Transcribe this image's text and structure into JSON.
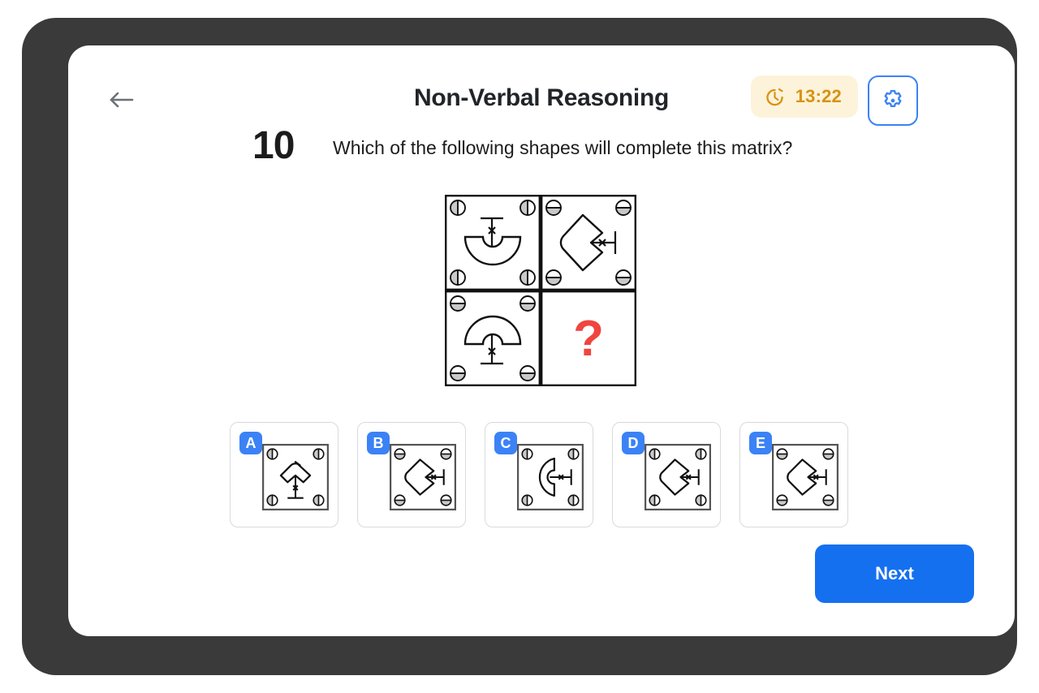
{
  "header": {
    "back_icon": "arrow-left-icon",
    "title": "Non-Verbal Reasoning",
    "timer": {
      "icon": "clock-icon",
      "value": "13:22",
      "bg_color": "#fdf3da",
      "text_color": "#d79311"
    },
    "settings": {
      "icon": "gear-icon",
      "accent_color": "#3b82f6"
    }
  },
  "question": {
    "number": "10",
    "text": "Which of the following shapes will complete this matrix?"
  },
  "matrix": {
    "missing_marker": "?",
    "missing_marker_color": "#f0453f",
    "cells": [
      {
        "position": "top-left",
        "corner_marker": "circle-split-vertical-left-shaded",
        "shape": "semicircle-down-notched",
        "stem": "vertical-line-top-tee-with-x"
      },
      {
        "position": "top-right",
        "corner_marker": "circle-split-horizontal-bottom-shaded",
        "shape": "chevron-left",
        "stem": "horizontal-line-right-tee-with-x"
      },
      {
        "position": "bottom-left",
        "corner_marker": "circle-split-horizontal-bottom-shaded",
        "shape": "semicircle-up-notched",
        "stem": "vertical-line-bottom-tee-with-x"
      },
      {
        "position": "bottom-right",
        "corner_marker": "none",
        "shape": "unknown",
        "stem": "none"
      }
    ]
  },
  "options": [
    {
      "label": "A",
      "corner_marker": "circle-split-vertical-left-shaded",
      "shape": "chevron-up",
      "stem": "vertical-line-bottom-tee-with-x"
    },
    {
      "label": "B",
      "corner_marker": "circle-split-horizontal-bottom-shaded",
      "shape": "chevron-left",
      "stem": "horizontal-line-right-tee-with-x"
    },
    {
      "label": "C",
      "corner_marker": "circle-split-vertical-left-shaded",
      "shape": "semicircle-left-notched",
      "stem": "horizontal-line-right-tee-with-x"
    },
    {
      "label": "D",
      "corner_marker": "circle-split-vertical-left-shaded",
      "shape": "chevron-left",
      "stem": "horizontal-line-right-tee-with-x"
    },
    {
      "label": "E",
      "corner_marker": "circle-split-horizontal-bottom-shaded",
      "shape": "chevron-left",
      "stem": "horizontal-line-right-tee-with-x"
    }
  ],
  "footer": {
    "next_label": "Next",
    "next_color": "#1570f0"
  }
}
